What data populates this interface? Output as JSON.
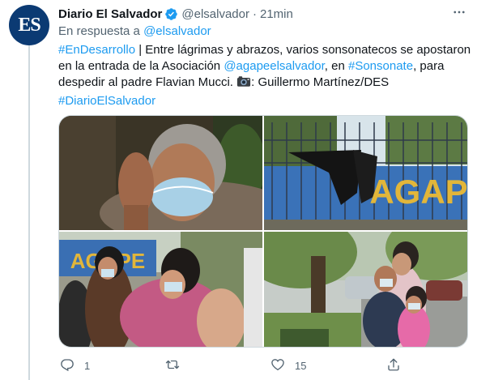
{
  "tweet": {
    "author_name": "Diario El Salvador",
    "author_handle": "@elsalvador",
    "separator": "·",
    "time": "21min",
    "avatar_initials": "ES",
    "reply_prefix": "En respuesta a",
    "reply_mention": "@elsalvador",
    "text": {
      "hashtag1": "#EnDesarrollo",
      "part1": " | Entre lágrimas y abrazos, varios sonsonatecos se apostaron en la entrada de la Asociación ",
      "mention": "@agapeelsalvador",
      "part2": ", en ",
      "hashtag2": "#Sonsonate",
      "part3": ", para despedir al padre Flavian Mucci. ",
      "part4": ": Guillermo Martínez/DES",
      "hashtag3": "#DiarioElSalvador"
    }
  },
  "media": {
    "photo2_sign_text": "AGAPE",
    "photo3_sign_text": "AGAPE"
  },
  "actions": {
    "reply_count": "1",
    "retweet_count": "",
    "like_count": "15"
  },
  "colors": {
    "link": "#1d9bf0",
    "secondary_text": "#536471",
    "verified": "#1d9bf0",
    "avatar_bg": "#0b3a73"
  }
}
